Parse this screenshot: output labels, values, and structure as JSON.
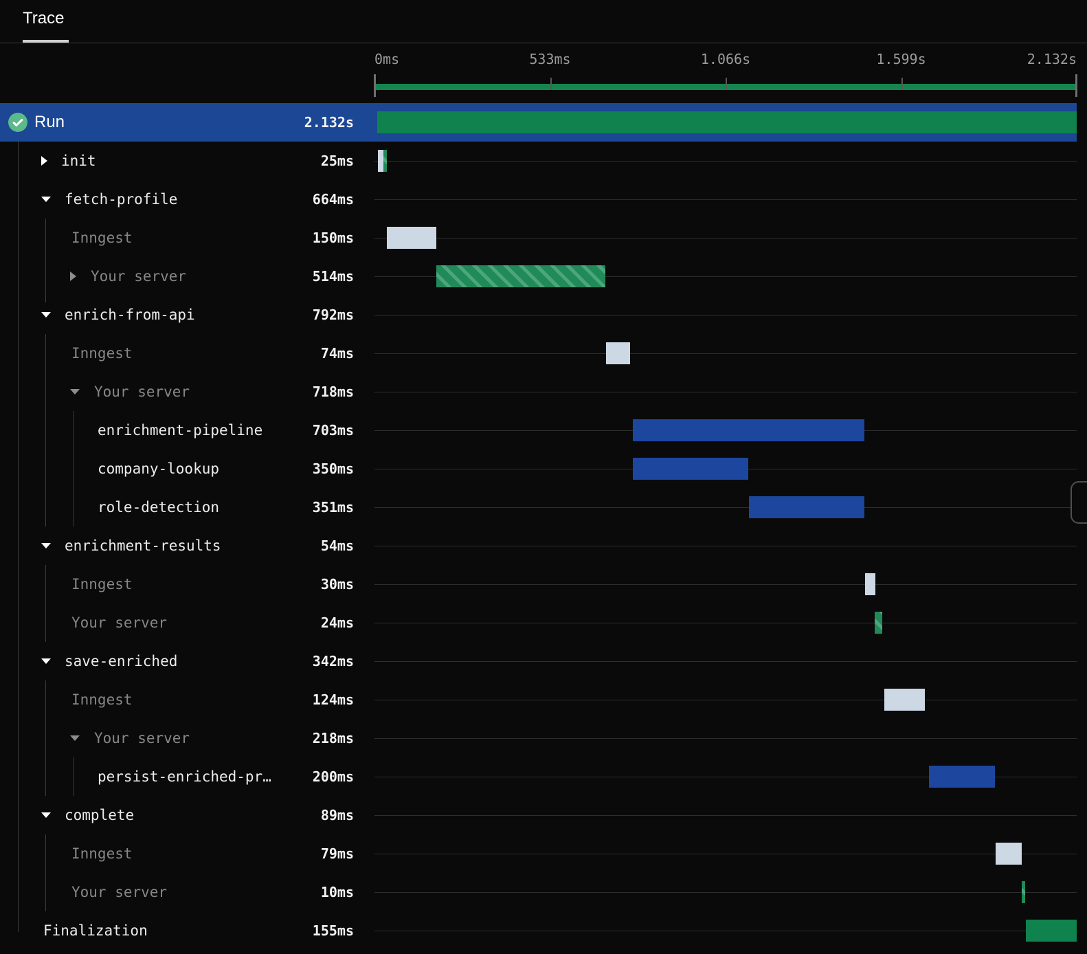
{
  "header": {
    "tab": "Trace"
  },
  "ruler": {
    "total_ms": 2132,
    "labels": [
      "0ms",
      "533ms",
      "1.066s",
      "1.599s",
      "2.132s"
    ]
  },
  "colors": {
    "selected_row_blue": "#1b4795",
    "run_green": "#0f824e",
    "queue_light": "#ccd8e4",
    "server_hatch_green": "#208a58",
    "server_hatch_stripe": "#4da57d",
    "step_blue": "#1d469f",
    "minimap_green": "#15854f",
    "check_icon_green": "#5cb98a"
  },
  "rows": [
    {
      "label": "Run",
      "duration": "2.132s",
      "level": 0,
      "chevron": null,
      "muted": false,
      "selected": true,
      "icon": "check-circle",
      "bars": [
        {
          "kind": "run",
          "start": 8,
          "dur": 2124
        }
      ]
    },
    {
      "label": "init",
      "duration": "25ms",
      "level": 0,
      "chevron": "right",
      "muted": false,
      "bars": [
        {
          "kind": "queue",
          "start": 10,
          "dur": 17
        },
        {
          "kind": "server",
          "start": 27,
          "dur": 10
        }
      ]
    },
    {
      "label": "fetch-profile",
      "duration": "664ms",
      "level": 0,
      "chevron": "down",
      "muted": false,
      "bars": []
    },
    {
      "label": "Inngest",
      "duration": "150ms",
      "level": 1,
      "chevron": null,
      "muted": true,
      "bars": [
        {
          "kind": "queue",
          "start": 37,
          "dur": 150
        }
      ]
    },
    {
      "label": "Your server",
      "duration": "514ms",
      "level": 1,
      "chevron": "right",
      "muted": true,
      "bars": [
        {
          "kind": "server",
          "start": 187,
          "dur": 514
        }
      ]
    },
    {
      "label": "enrich-from-api",
      "duration": "792ms",
      "level": 0,
      "chevron": "down",
      "muted": false,
      "bars": []
    },
    {
      "label": "Inngest",
      "duration": "74ms",
      "level": 1,
      "chevron": null,
      "muted": true,
      "bars": [
        {
          "kind": "queue",
          "start": 702,
          "dur": 74
        }
      ]
    },
    {
      "label": "Your server",
      "duration": "718ms",
      "level": 1,
      "chevron": "down",
      "muted": true,
      "bars": []
    },
    {
      "label": "enrichment-pipeline",
      "duration": "703ms",
      "level": 2,
      "chevron": null,
      "muted": false,
      "bars": [
        {
          "kind": "step",
          "start": 784,
          "dur": 703
        }
      ]
    },
    {
      "label": "company-lookup",
      "duration": "350ms",
      "level": 2,
      "chevron": null,
      "muted": false,
      "bars": [
        {
          "kind": "step",
          "start": 784,
          "dur": 350
        }
      ]
    },
    {
      "label": "role-detection",
      "duration": "351ms",
      "level": 2,
      "chevron": null,
      "muted": false,
      "bars": [
        {
          "kind": "step",
          "start": 1136,
          "dur": 351
        }
      ]
    },
    {
      "label": "enrichment-results",
      "duration": "54ms",
      "level": 0,
      "chevron": "down",
      "muted": false,
      "bars": []
    },
    {
      "label": "Inngest",
      "duration": "30ms",
      "level": 1,
      "chevron": null,
      "muted": true,
      "bars": [
        {
          "kind": "queue",
          "start": 1490,
          "dur": 30
        }
      ]
    },
    {
      "label": "Your server",
      "duration": "24ms",
      "level": 1,
      "chevron": null,
      "muted": true,
      "bars": [
        {
          "kind": "server",
          "start": 1518,
          "dur": 24
        }
      ]
    },
    {
      "label": "save-enriched",
      "duration": "342ms",
      "level": 0,
      "chevron": "down",
      "muted": false,
      "bars": []
    },
    {
      "label": "Inngest",
      "duration": "124ms",
      "level": 1,
      "chevron": null,
      "muted": true,
      "bars": [
        {
          "kind": "queue",
          "start": 1547,
          "dur": 124
        }
      ]
    },
    {
      "label": "Your server",
      "duration": "218ms",
      "level": 1,
      "chevron": "down",
      "muted": true,
      "bars": []
    },
    {
      "label": "persist-enriched-pr…",
      "duration": "200ms",
      "level": 2,
      "chevron": null,
      "muted": false,
      "bars": [
        {
          "kind": "step",
          "start": 1683,
          "dur": 200
        }
      ]
    },
    {
      "label": "complete",
      "duration": "89ms",
      "level": 0,
      "chevron": "down",
      "muted": false,
      "bars": []
    },
    {
      "label": "Inngest",
      "duration": "79ms",
      "level": 1,
      "chevron": null,
      "muted": true,
      "bars": [
        {
          "kind": "queue",
          "start": 1886,
          "dur": 79
        }
      ]
    },
    {
      "label": "Your server",
      "duration": "10ms",
      "level": 1,
      "chevron": null,
      "muted": true,
      "bars": [
        {
          "kind": "server",
          "start": 1966,
          "dur": 10
        }
      ]
    },
    {
      "label": "Finalization",
      "duration": "155ms",
      "level": 0,
      "chevron": null,
      "muted": false,
      "bars": [
        {
          "kind": "final",
          "start": 1977,
          "dur": 155
        }
      ]
    }
  ]
}
